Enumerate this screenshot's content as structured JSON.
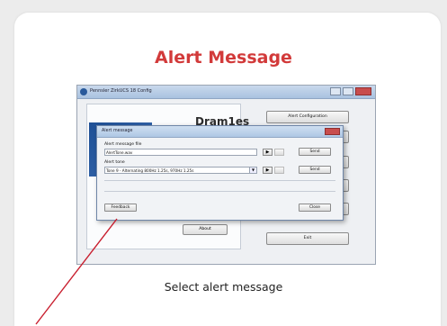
{
  "slide": {
    "title": "Alert Message",
    "caption": "Select alert message"
  },
  "screenshot": {
    "main_window": {
      "title": "Pennsler ZirkUCS 18 Config",
      "brand_text": "Dram1es",
      "buttons": [
        "Alert Configuration",
        "Exit"
      ],
      "about_label": "About"
    },
    "dialog": {
      "title": "Alert message",
      "file_label": "Alert message file",
      "file_value": "AlertTone.wav",
      "tone_label": "Alert tone",
      "tone_value": "Tone 9 - Alternating 800Hz 1.25s, 970Hz 1.25s",
      "send_label": "Send",
      "feedback_label": "Feedback",
      "close_label": "Close",
      "play_symbol": "▶"
    }
  },
  "colors": {
    "title": "#d23a3a",
    "pointer_line": "#c81e2e"
  }
}
